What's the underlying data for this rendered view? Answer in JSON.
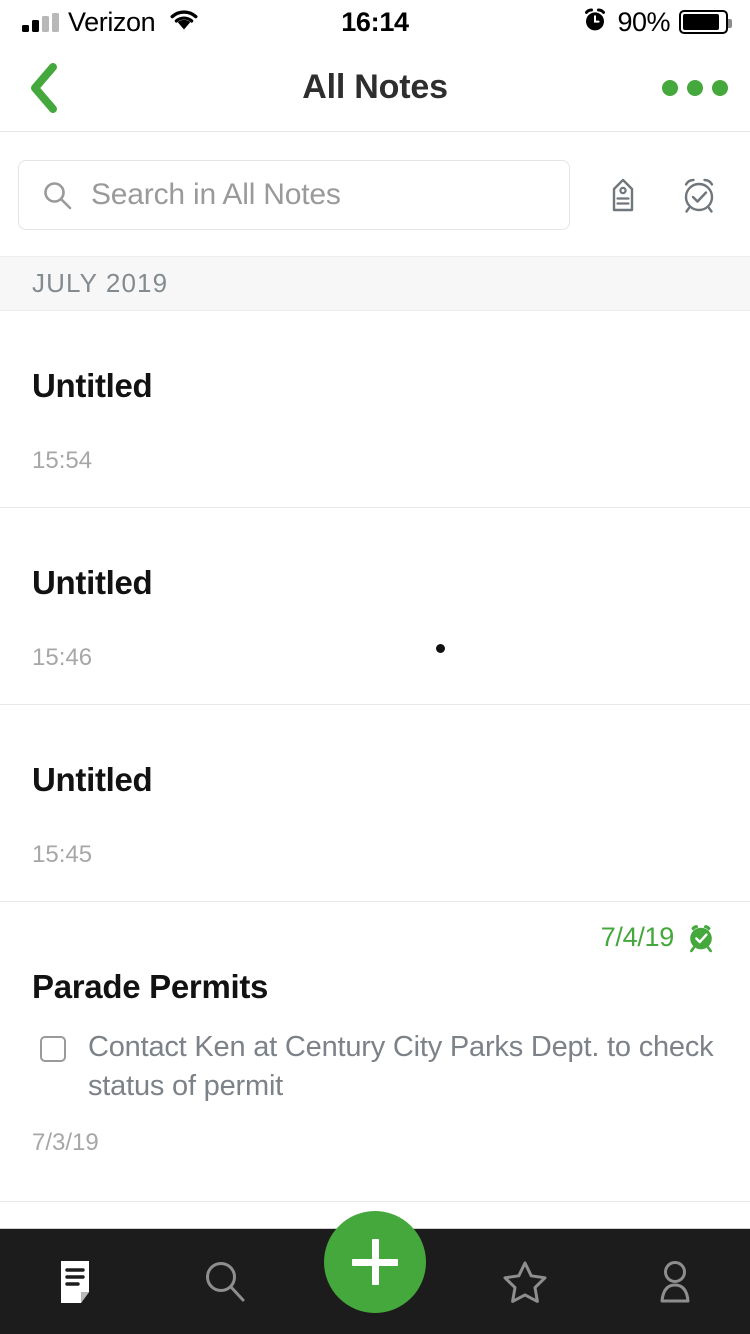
{
  "status_bar": {
    "carrier": "Verizon",
    "time": "16:14",
    "battery_percent": "90%",
    "signal_icon": "signal-bars-icon",
    "wifi_icon": "wifi-icon",
    "alarm_icon": "alarm-clock-icon",
    "battery_icon": "battery-icon"
  },
  "nav_bar": {
    "title": "All Notes",
    "back_icon": "back-chevron-icon",
    "more_icon": "more-options-icon",
    "accent_color": "#45a83c"
  },
  "search": {
    "placeholder": "Search in All Notes",
    "search_icon": "search-icon",
    "tag_icon": "tag-icon",
    "reminder_icon": "alarm-check-icon"
  },
  "section": {
    "month_header": "JULY 2019"
  },
  "notes": [
    {
      "title": "Untitled",
      "time": "15:54",
      "type": "plain"
    },
    {
      "title": "Untitled",
      "time": "15:46",
      "type": "plain"
    },
    {
      "title": "Untitled",
      "time": "15:45",
      "type": "plain"
    },
    {
      "title": "Parade Permits",
      "time": "7/3/19",
      "type": "rich",
      "reminder_date": "7/4/19",
      "reminder_icon": "alarm-check-filled-icon",
      "todo": {
        "checked": false,
        "text": "Contact Ken at Century City Parks Dept. to check status of permit"
      }
    }
  ],
  "tab_bar": {
    "background": "#1c1c1c",
    "items": [
      {
        "icon": "notes-icon",
        "active": true
      },
      {
        "icon": "search-icon",
        "active": false
      },
      {
        "icon": "star-icon",
        "active": false
      },
      {
        "icon": "account-icon",
        "active": false
      }
    ],
    "fab": {
      "icon": "plus-icon",
      "color": "#45a83c"
    }
  }
}
